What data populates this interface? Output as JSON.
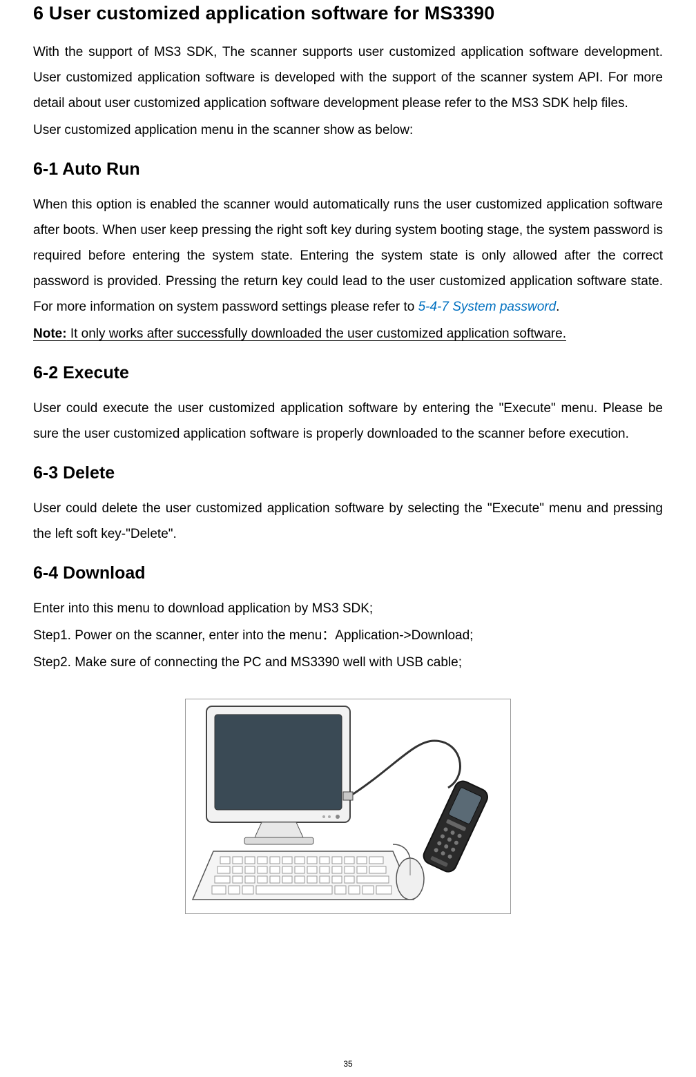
{
  "headings": {
    "main": "6 User customized application software for MS3390",
    "h61": "6-1 Auto Run",
    "h62": "6-2 Execute",
    "h63": "6-3 Delete",
    "h64": "6-4 Download"
  },
  "intro": {
    "p1": "With the support of MS3 SDK, The scanner supports user customized application software development. User customized application software is developed with the support of the scanner system API. For more detail about user customized application software development please refer to the MS3 SDK help files.",
    "p2": "User customized application menu in the scanner show as below:"
  },
  "section61": {
    "body_before_link": "When this option is enabled the scanner would automatically runs the user customized application software after boots. When user keep pressing the right soft key during system booting stage, the system password is required before entering the system state. Entering the system state is only allowed after the correct password is provided. Pressing the return key could lead to the user customized application software state. For more information on system password settings please refer to ",
    "link_text": "5-4-7 System password",
    "period": ".",
    "note_label": "Note:",
    "note_text": " It only works after successfully downloaded the user customized application software."
  },
  "section62": {
    "body": "User could execute the user customized application software by entering the \"Execute\" menu. Please be sure the user customized application software is properly downloaded to the scanner before execution."
  },
  "section63": {
    "body": "User could delete the user customized application software by selecting the \"Execute\" menu and pressing the left soft key-\"Delete\"."
  },
  "section64": {
    "line1": "Enter into this menu to download application by MS3 SDK;",
    "line2": "Step1. Power on the scanner, enter into the menu：Application->Download;",
    "line3": "Step2. Make sure of connecting the PC and MS3390 well with USB cable;"
  },
  "figure": {
    "alt": "computer-keyboard-and-scanner-usb-illustration"
  },
  "page_number": "35"
}
